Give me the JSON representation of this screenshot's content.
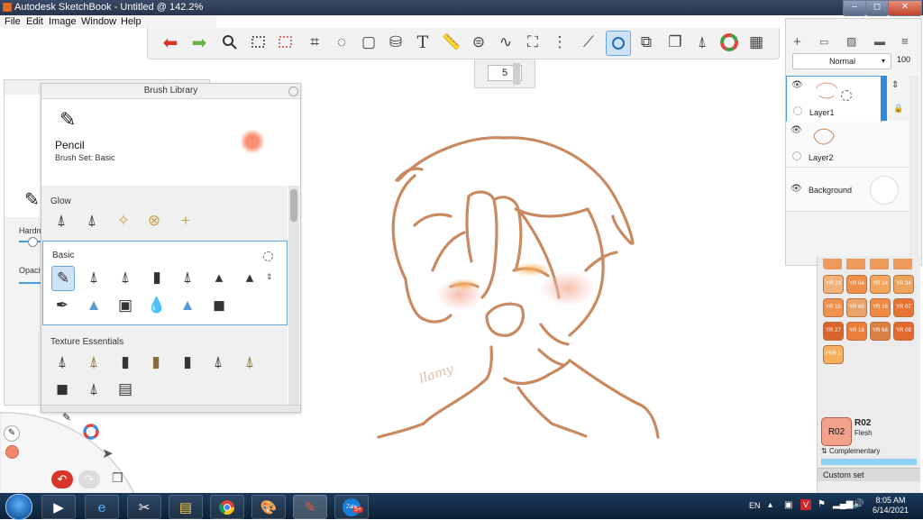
{
  "window": {
    "title": "Autodesk SketchBook - Untitled @ 142.2%",
    "min": "–",
    "max": "◻",
    "close": "✕"
  },
  "menu": [
    "File",
    "Edit",
    "Image",
    "Window",
    "Help"
  ],
  "brush_size": "5",
  "brush_props": {
    "hardness_label": "Hardne",
    "opacity_label": "Opacit"
  },
  "brush_library": {
    "title": "Brush Library",
    "current_brush": "Pencil",
    "brush_set": "Brush Set: Basic",
    "sections": [
      "Glow",
      "Basic",
      "Texture Essentials"
    ]
  },
  "layers": {
    "blend_mode": "Normal",
    "opacity": "100",
    "items": [
      "Layer1",
      "Layer2",
      "Background"
    ]
  },
  "palette": {
    "swatches": [
      [
        "YR 23",
        "YR 04",
        "YR 14",
        "YR 34"
      ],
      [
        "YR 15",
        "YR 65",
        "YR 16",
        "YR 07"
      ],
      [
        "YR 27",
        "YR 18",
        "YR 68",
        "YR 09"
      ],
      [
        "FYR 1"
      ]
    ],
    "swatch_colors": [
      [
        "#f4b27a",
        "#ef8f4a",
        "#f3a65e",
        "#eea35e"
      ],
      [
        "#f0924f",
        "#e9a46b",
        "#ef8a44",
        "#e77433"
      ],
      [
        "#d9652b",
        "#ec7d3a",
        "#d98045",
        "#e2682b"
      ],
      [
        "#f6b15c"
      ]
    ],
    "selected_code": "R02",
    "selected_title": "R02",
    "selected_name": "Flesh",
    "selected_color": "#f4a18c",
    "complementary": "Complementary",
    "custom_set": "Custom set"
  },
  "canvas": {
    "stroke_color": "#c98a62",
    "signature": "llamy"
  },
  "taskbar": {
    "zalo_badge": "5+",
    "zalo_label": "Zalo",
    "lang": "EN",
    "time": "8:05 AM",
    "date": "6/14/2021"
  }
}
